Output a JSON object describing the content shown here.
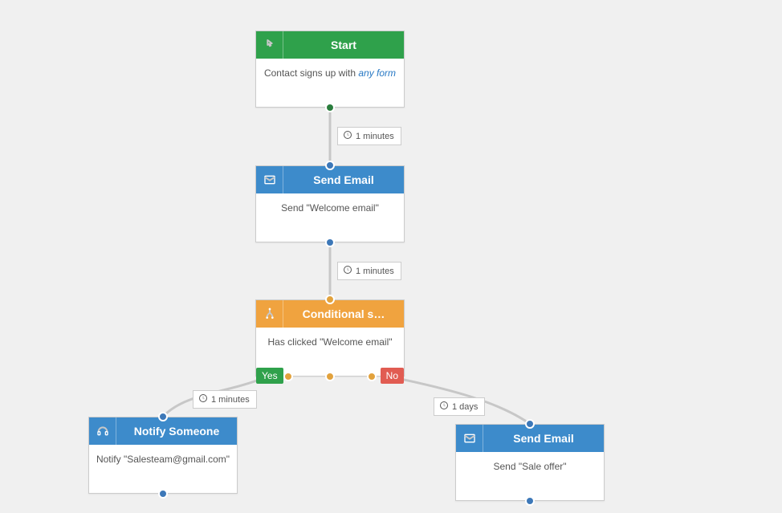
{
  "nodes": {
    "start": {
      "title": "Start",
      "body_prefix": "Contact signs up with ",
      "body_link": "any form"
    },
    "send_email_1": {
      "title": "Send Email",
      "body": "Send \"Welcome email\""
    },
    "conditional": {
      "title": "Conditional s…",
      "body": "Has clicked \"Welcome email\"",
      "yes_label": "Yes",
      "no_label": "No"
    },
    "notify": {
      "title": "Notify Someone",
      "body": "Notify \"Salesteam@gmail.com\""
    },
    "send_email_2": {
      "title": "Send Email",
      "body": "Send \"Sale offer\""
    }
  },
  "delays": {
    "d1": "1 minutes",
    "d2": "1 minutes",
    "d3": "1 minutes",
    "d4": "1 days"
  },
  "icons": {
    "pointer": "pointer-icon",
    "mail": "mail-icon",
    "split": "split-icon",
    "headset": "headset-icon",
    "clock": "clock-icon"
  }
}
